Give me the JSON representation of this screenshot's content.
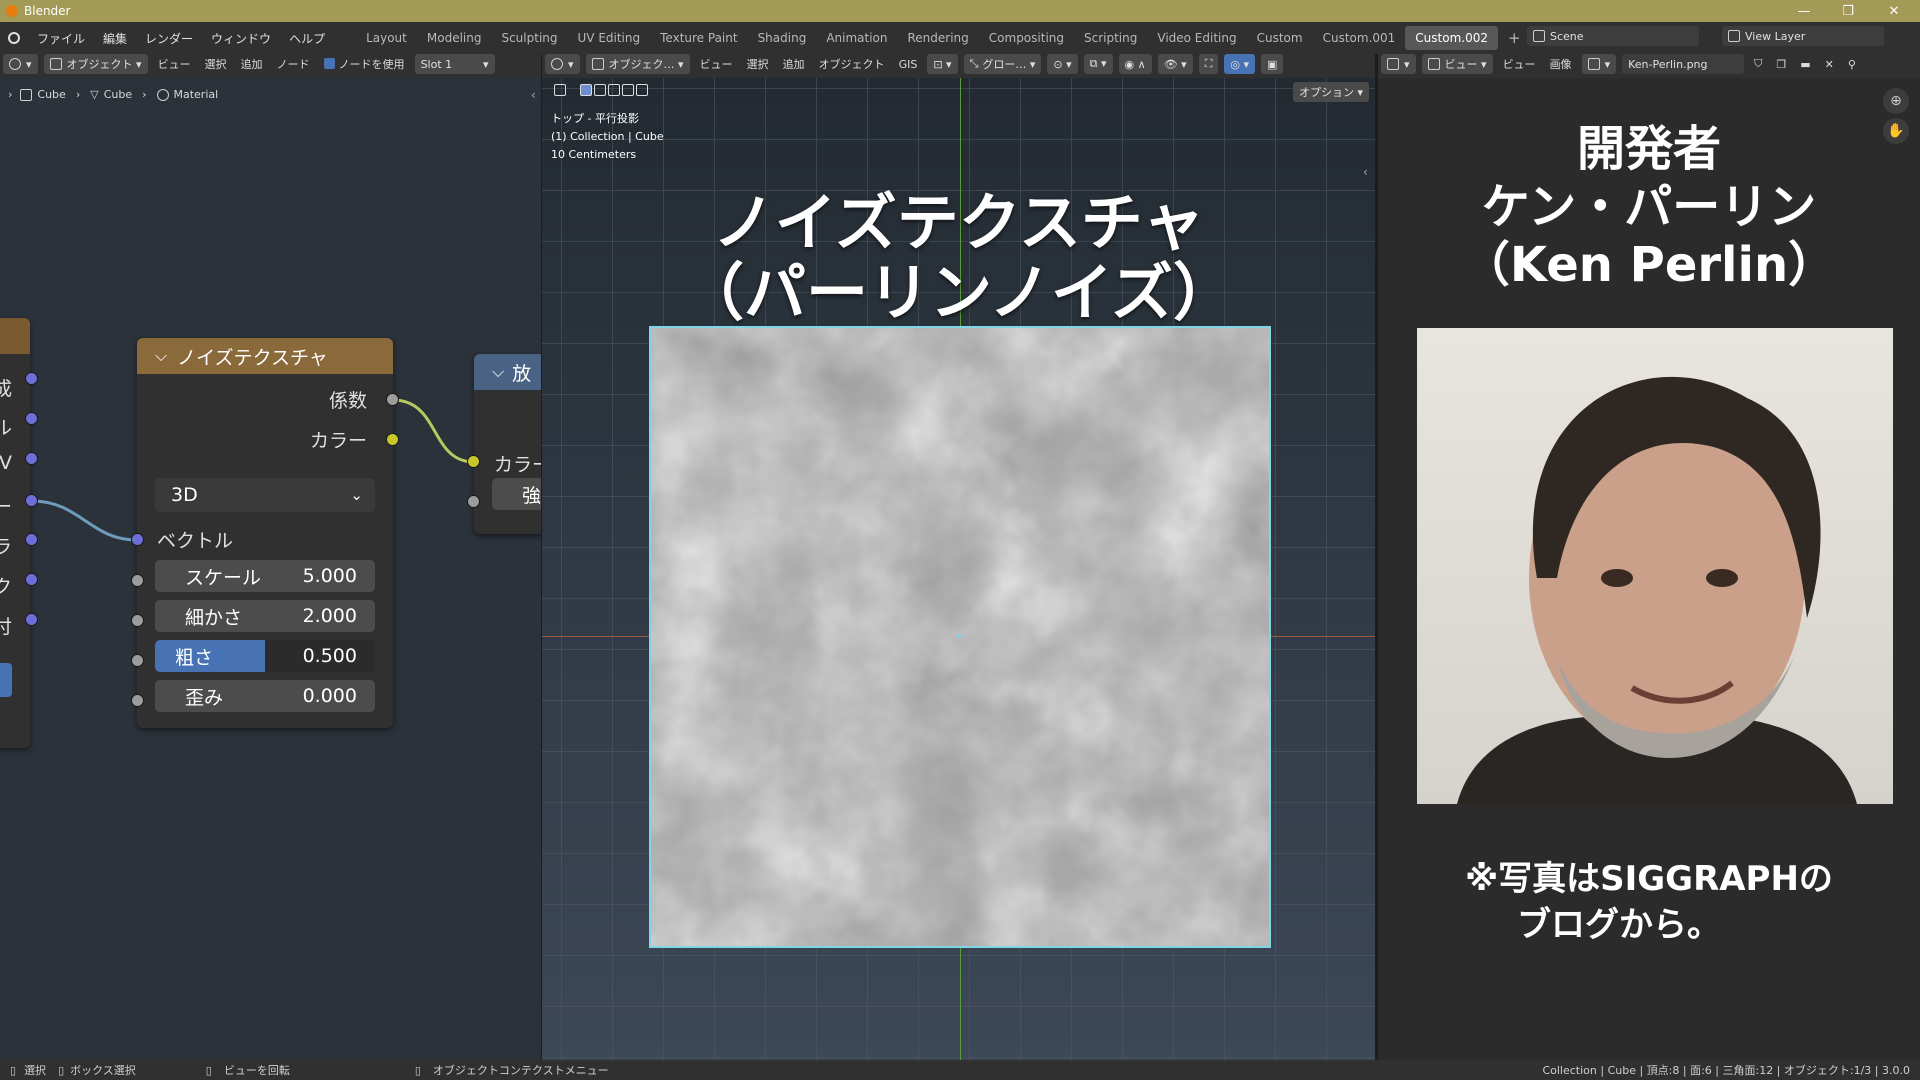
{
  "window": {
    "title": "Blender"
  },
  "menu": [
    "ファイル",
    "編集",
    "レンダー",
    "ウィンドウ",
    "ヘルプ"
  ],
  "workspaces": [
    "Layout",
    "Modeling",
    "Sculpting",
    "UV Editing",
    "Texture Paint",
    "Shading",
    "Animation",
    "Rendering",
    "Compositing",
    "Scripting",
    "Video Editing",
    "Custom",
    "Custom.001",
    "Custom.002"
  ],
  "active_workspace": "Custom.002",
  "scene": {
    "name": "Scene",
    "view_layer": "View Layer"
  },
  "node_header": {
    "mode": "オブジェクト",
    "view": "ビュー",
    "select": "選択",
    "add": "追加",
    "node": "ノード",
    "use_nodes": "ノードを使用",
    "slot": "Slot 1"
  },
  "breadcrumb": [
    "Cube",
    "Cube",
    "Material"
  ],
  "noise_node": {
    "title": "ノイズテクスチャ",
    "outputs": [
      "係数",
      "カラー"
    ],
    "dimension": "3D",
    "vector": "ベクトル",
    "fields": [
      {
        "label": "スケール",
        "value": "5.000"
      },
      {
        "label": "細かさ",
        "value": "2.000"
      },
      {
        "label": "粗さ",
        "value": "0.500"
      },
      {
        "label": "歪み",
        "value": "0.000"
      }
    ],
    "roughness_fraction": 0.5
  },
  "left_node_labels": [
    "成",
    "ル",
    "V",
    "ー",
    "ラ",
    "ク",
    "付"
  ],
  "emission_node": {
    "title": "放",
    "color": "カラー",
    "strength": "強"
  },
  "viewport_header": {
    "mode": "オブジェク…",
    "view": "ビュー",
    "select": "選択",
    "add": "追加",
    "object": "オブジェクト",
    "gis": "GIS",
    "transform": "グロー…",
    "options": "オプション"
  },
  "viewport_info": [
    "トップ - 平行投影",
    "(1) Collection | Cube",
    "10 Centimeters"
  ],
  "viewport_title": [
    "ノイズテクスチャ",
    "（パーリンノイズ）"
  ],
  "image_header": {
    "view": "ビュー",
    "view2": "ビュー",
    "image": "画像",
    "filename": "Ken-Perlin.png"
  },
  "developer": {
    "line1": "開発者",
    "line2": "ケン・パーリン",
    "line3": "（Ken Perlin）"
  },
  "photo_note": {
    "line1": "※写真はSIGGRAPHの",
    "line2": "ブログから。"
  },
  "status": {
    "select": "選択",
    "box_select": "ボックス選択",
    "rotate": "ビューを回転",
    "context": "オブジェクトコンテクストメニュー",
    "stats": "Collection | Cube | 頂点:8 | 面:6 | 三角面:12 | オブジェクト:1/3 | 3.0.0"
  },
  "colors": {
    "title_bar": "#a39a58",
    "node_header": "#8a6a3a",
    "texture_header": "#7a5a30",
    "accent_blue": "#4772b3",
    "socket_blue": "#6e6ed8",
    "socket_yellow": "#c7c729",
    "socket_grey": "#9c9c9c",
    "noise_border": "#7fd4e6"
  }
}
